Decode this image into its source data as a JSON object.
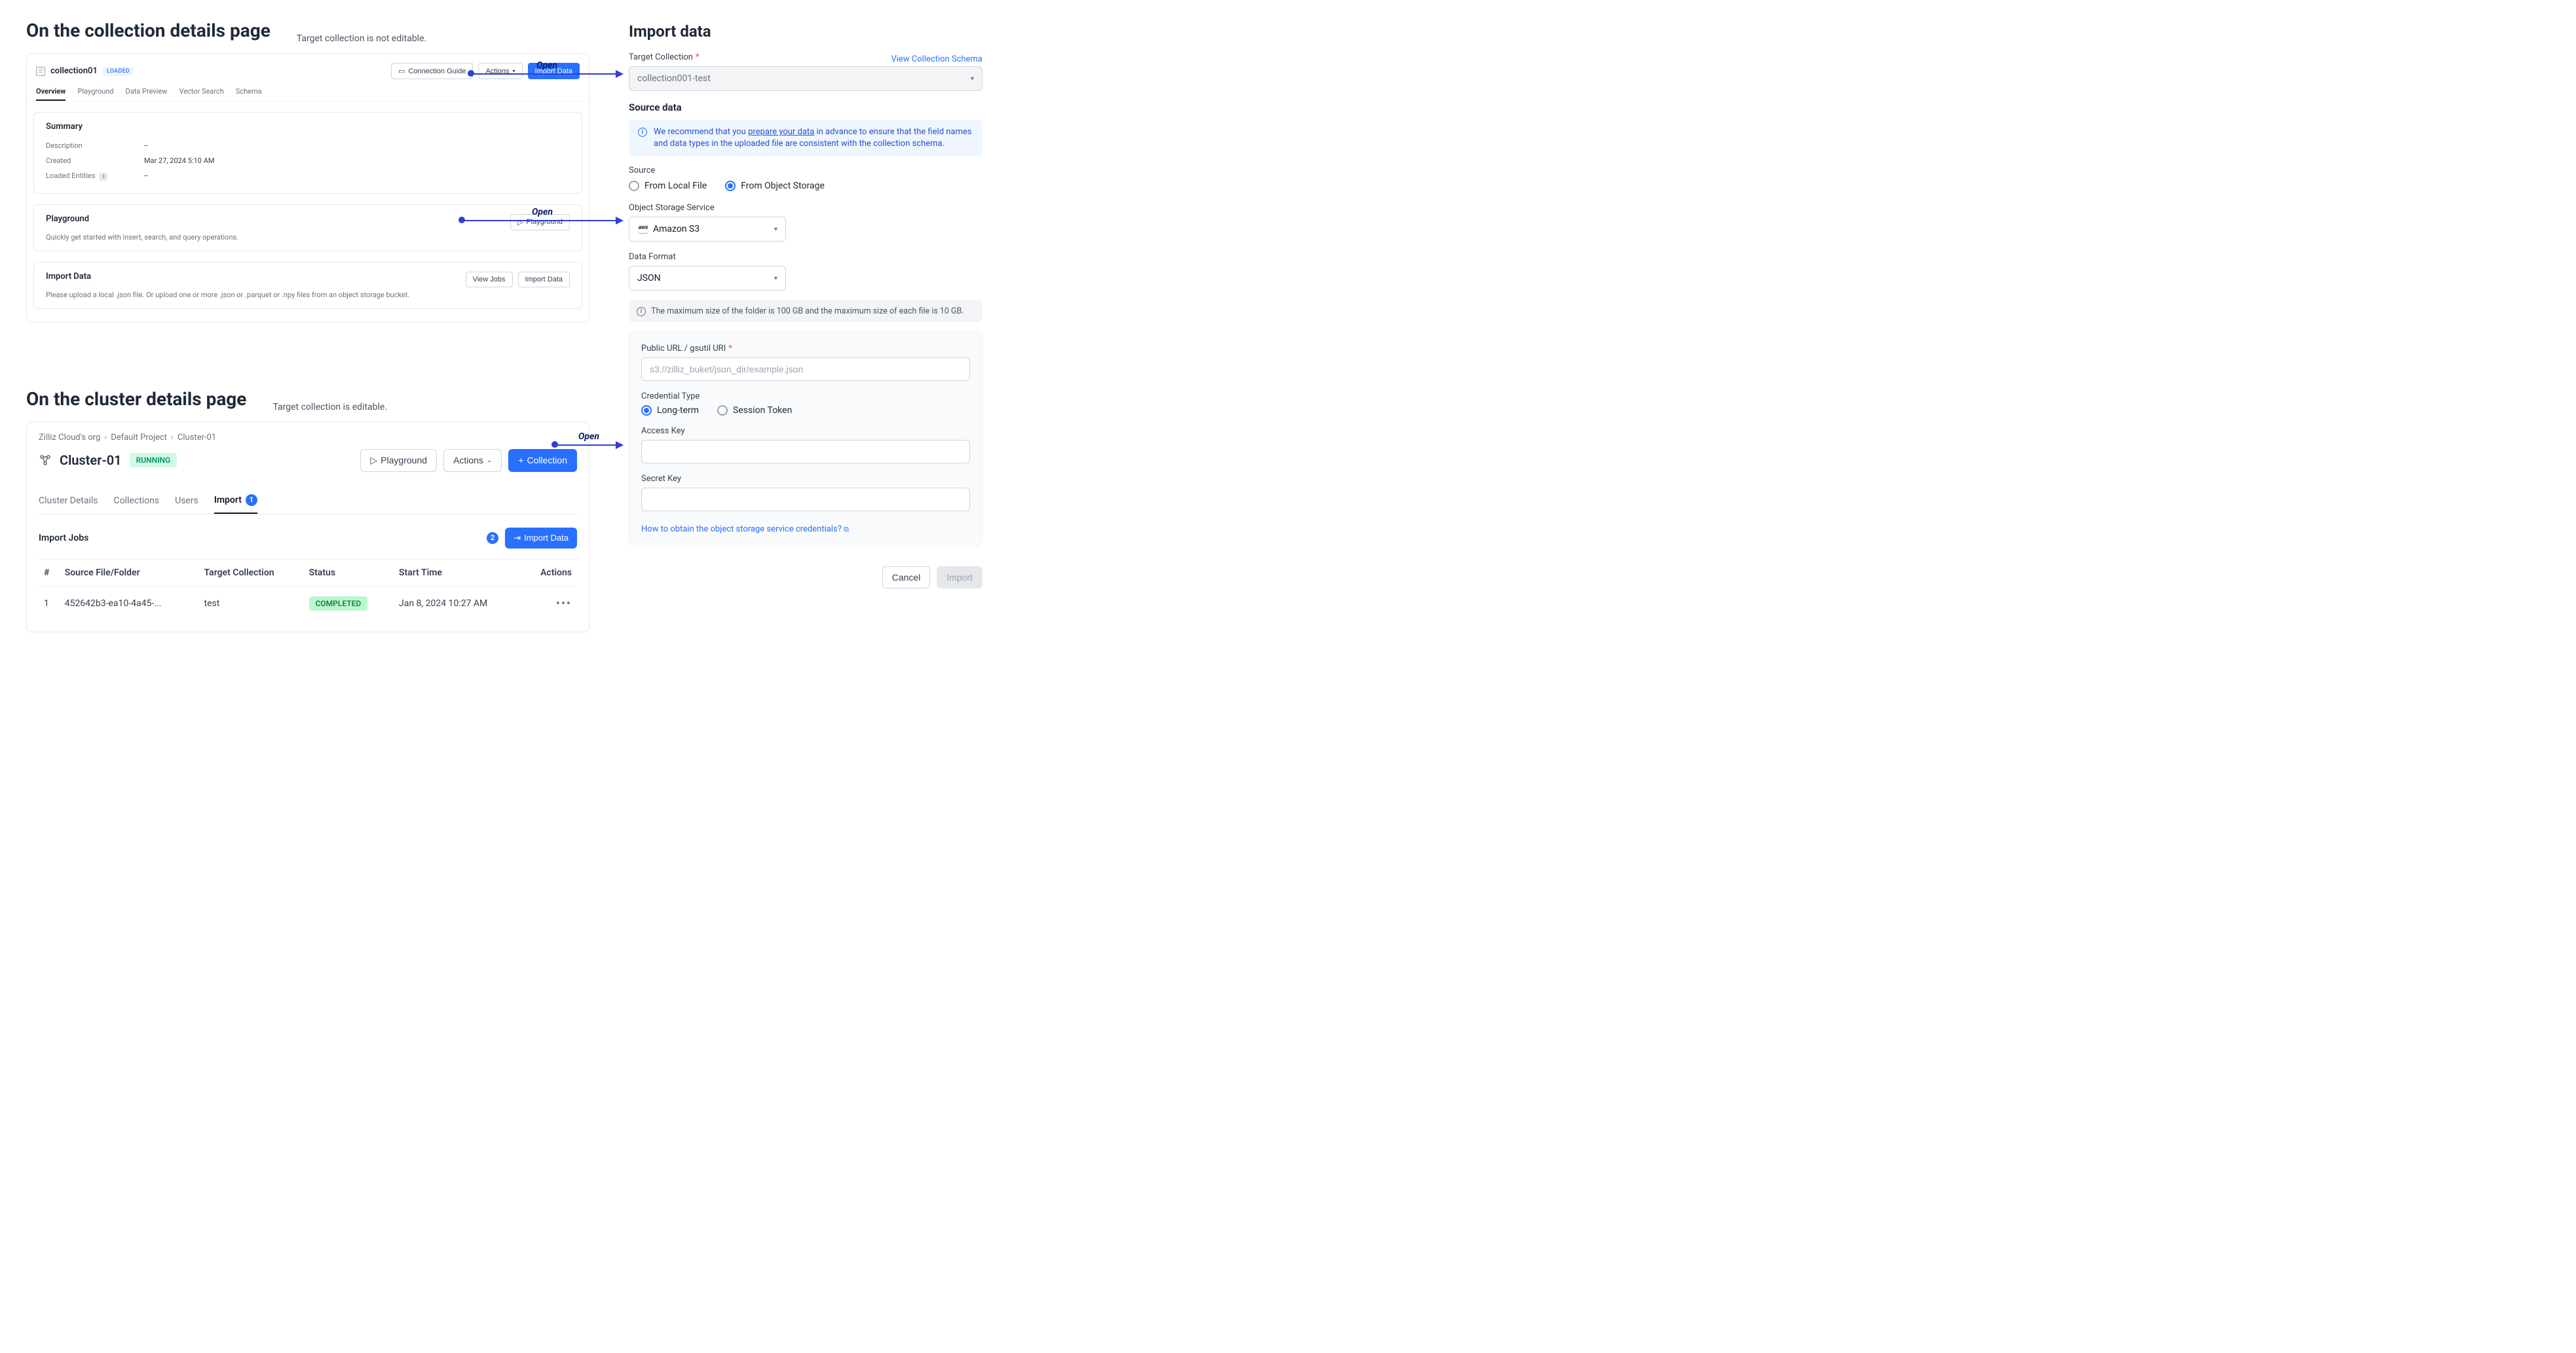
{
  "left": {
    "section1": {
      "title": "On the collection details page",
      "subtitle": "Target collection is not editable.",
      "collection_name": "collection01",
      "loaded_badge": "LOADED",
      "connection_guide_btn": "Connection Guide",
      "actions_btn": "Actions",
      "import_data_btn": "Import Data",
      "tabs": [
        "Overview",
        "Playground",
        "Data Preview",
        "Vector Search",
        "Schema"
      ],
      "summary": {
        "title": "Summary",
        "rows": {
          "description_k": "Description",
          "description_v": "--",
          "created_k": "Created",
          "created_v": "Mar 27, 2024 5:10 AM",
          "loaded_k": "Loaded Entities",
          "loaded_v": "--"
        }
      },
      "playground_card": {
        "title": "Playground",
        "btn": "Playground",
        "desc": "Quickly get started with insert, search, and query operations."
      },
      "import_card": {
        "title": "Import Data",
        "view_jobs_btn": "View Jobs",
        "import_btn": "Import Data",
        "desc": "Please upload a local .json file. Or upload one or more .json or .parquet or .npy files from an object storage bucket."
      }
    },
    "section2": {
      "title": "On the cluster details page",
      "subtitle": "Target collection is editable.",
      "breadcrumb": [
        "Zilliz Cloud's org",
        "Default Project",
        "Cluster-01"
      ],
      "cluster_name": "Cluster-01",
      "running_badge": "RUNNING",
      "playground_btn": "Playground",
      "actions_btn": "Actions",
      "collection_btn": "Collection",
      "tabs2": [
        "Cluster Details",
        "Collections",
        "Users",
        "Import"
      ],
      "import_jobs_title": "Import Jobs",
      "import_data_btn": "Import Data",
      "table": {
        "headers": [
          "#",
          "Source File/Folder",
          "Target Collection",
          "Status",
          "Start Time",
          "Actions"
        ],
        "row": {
          "num": "1",
          "file": "452642b3-ea10-4a45-...",
          "collection": "test",
          "status": "COMPLETED",
          "start": "Jan 8, 2024 10:27 AM"
        }
      }
    }
  },
  "arrows": {
    "open1": "Open",
    "open2": "Open",
    "open3": "Open"
  },
  "right": {
    "title": "Import data",
    "target_collection_label": "Target Collection",
    "view_schema_link": "View Collection Schema",
    "target_collection_value": "collection001-test",
    "source_data_heading": "Source data",
    "info_pre": "We recommend that you ",
    "info_link": "prepare your data",
    "info_post": " in advance to ensure that the field names and data types in the uploaded file are consistent with the collection schema.",
    "source_label": "Source",
    "radio_local": "From Local File",
    "radio_object": "From Object Storage",
    "oss_label": "Object Storage Service",
    "oss_value": "Amazon S3",
    "format_label": "Data Format",
    "format_value": "JSON",
    "size_note": "The maximum size of the folder is 100 GB and the maximum size of each file is 10 GB.",
    "url_label": "Public URL / gsutil URI",
    "url_placeholder": "s3://zilliz_buket/json_dir/example.json",
    "cred_label": "Credential Type",
    "cred_long": "Long-term",
    "cred_session": "Session Token",
    "access_key_label": "Access Key",
    "secret_key_label": "Secret Key",
    "howto_link": "How to obtain the object storage service credentials?",
    "cancel_btn": "Cancel",
    "import_btn": "Import"
  }
}
